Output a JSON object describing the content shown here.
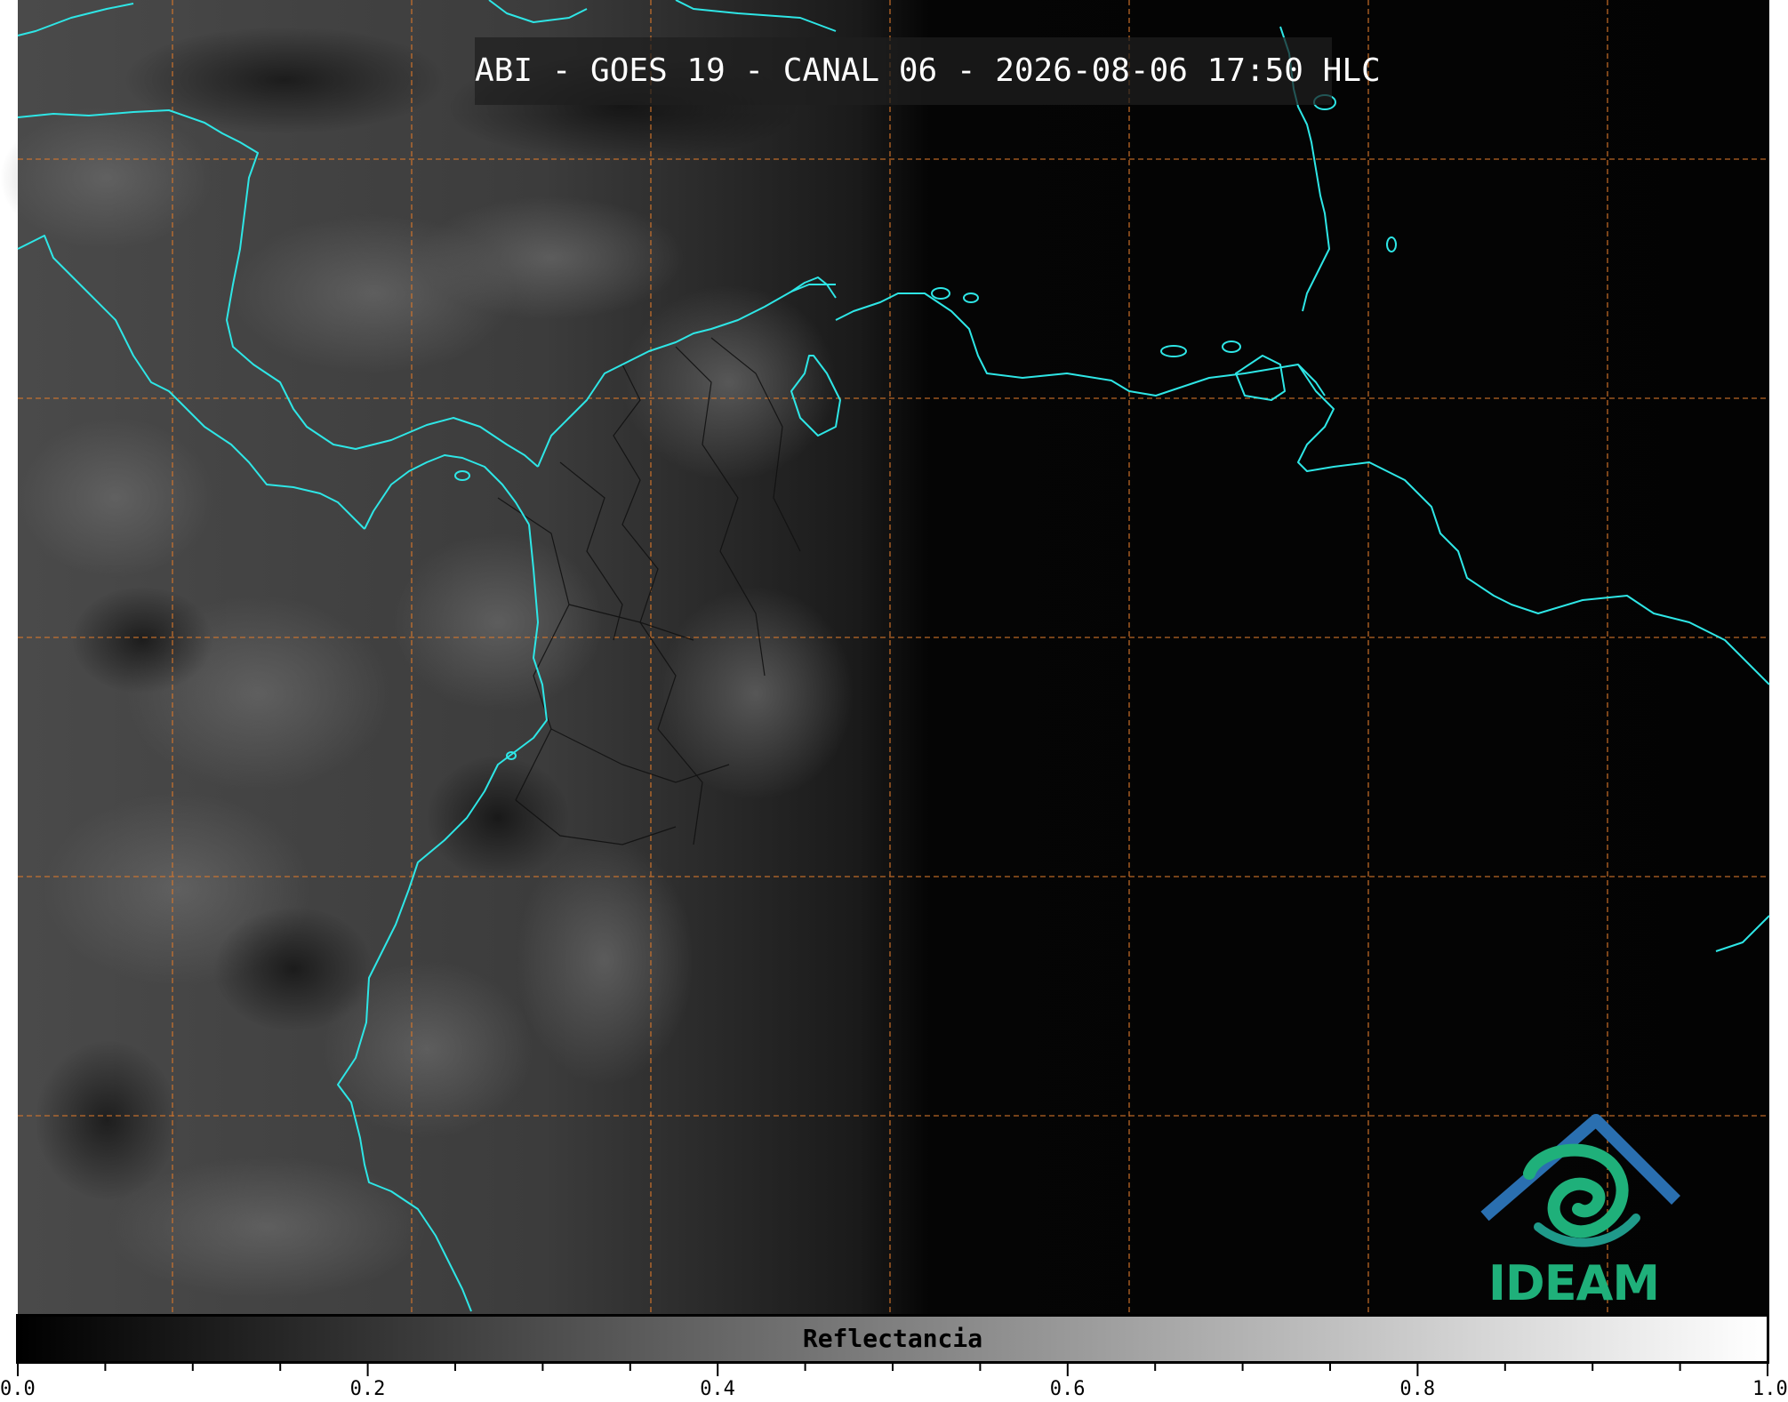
{
  "title": "ABI - GOES 19 - CANAL 06 - 2026-08-06 17:50 HLC",
  "logo": {
    "text": "IDEAM"
  },
  "colorbar": {
    "label": "Reflectancia",
    "min": 0.0,
    "max": 1.0,
    "tick_labels": [
      "0.0",
      "0.2",
      "0.4",
      "0.6",
      "0.8",
      "1.0"
    ],
    "colormap": [
      "#000000",
      "#ffffff"
    ]
  },
  "colors": {
    "coastline": "#2ee6e6",
    "grid": "#d9782b",
    "borders": "#111111",
    "logo_green": "#1fb07a",
    "logo_blue": "#2a6fb0"
  }
}
